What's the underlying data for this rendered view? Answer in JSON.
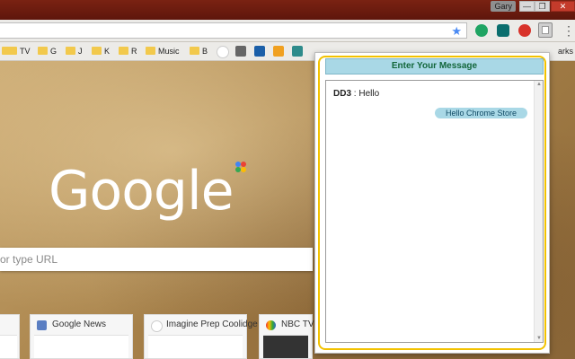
{
  "window": {
    "profile_name": "Gary",
    "min_glyph": "—",
    "max_glyph": "❐",
    "close_glyph": "✕"
  },
  "toolbar": {
    "star_glyph": "★",
    "menu_glyph": "⋮",
    "extensions": [
      "green-circle-extension",
      "teal-extension",
      "red-extension",
      "dd3-chat-extension"
    ]
  },
  "bookmarks": {
    "items": [
      {
        "label": "",
        "type": "folder"
      },
      {
        "label": "TV",
        "type": "folder"
      },
      {
        "label": "G",
        "type": "folder"
      },
      {
        "label": "J",
        "type": "folder"
      },
      {
        "label": "K",
        "type": "folder"
      },
      {
        "label": "R",
        "type": "folder"
      },
      {
        "label": "Music",
        "type": "folder"
      },
      {
        "label": "B",
        "type": "folder"
      }
    ],
    "more_label": "arks"
  },
  "newtab": {
    "logo_text": "Google",
    "search_placeholder": "or type URL",
    "tiles": [
      {
        "title": ""
      },
      {
        "title": "Google News"
      },
      {
        "title": "Imagine Prep Coolidge"
      },
      {
        "title": "NBC TV"
      }
    ]
  },
  "popup": {
    "header": "Enter Your Message",
    "incoming": {
      "sender": "DD3",
      "separator": " : ",
      "text": "Hello"
    },
    "outgoing": {
      "text": "Hello Chrome Store"
    }
  },
  "colors": {
    "accent": "#a9d8e6",
    "frame": "#f2c200",
    "header_text": "#12663a"
  }
}
